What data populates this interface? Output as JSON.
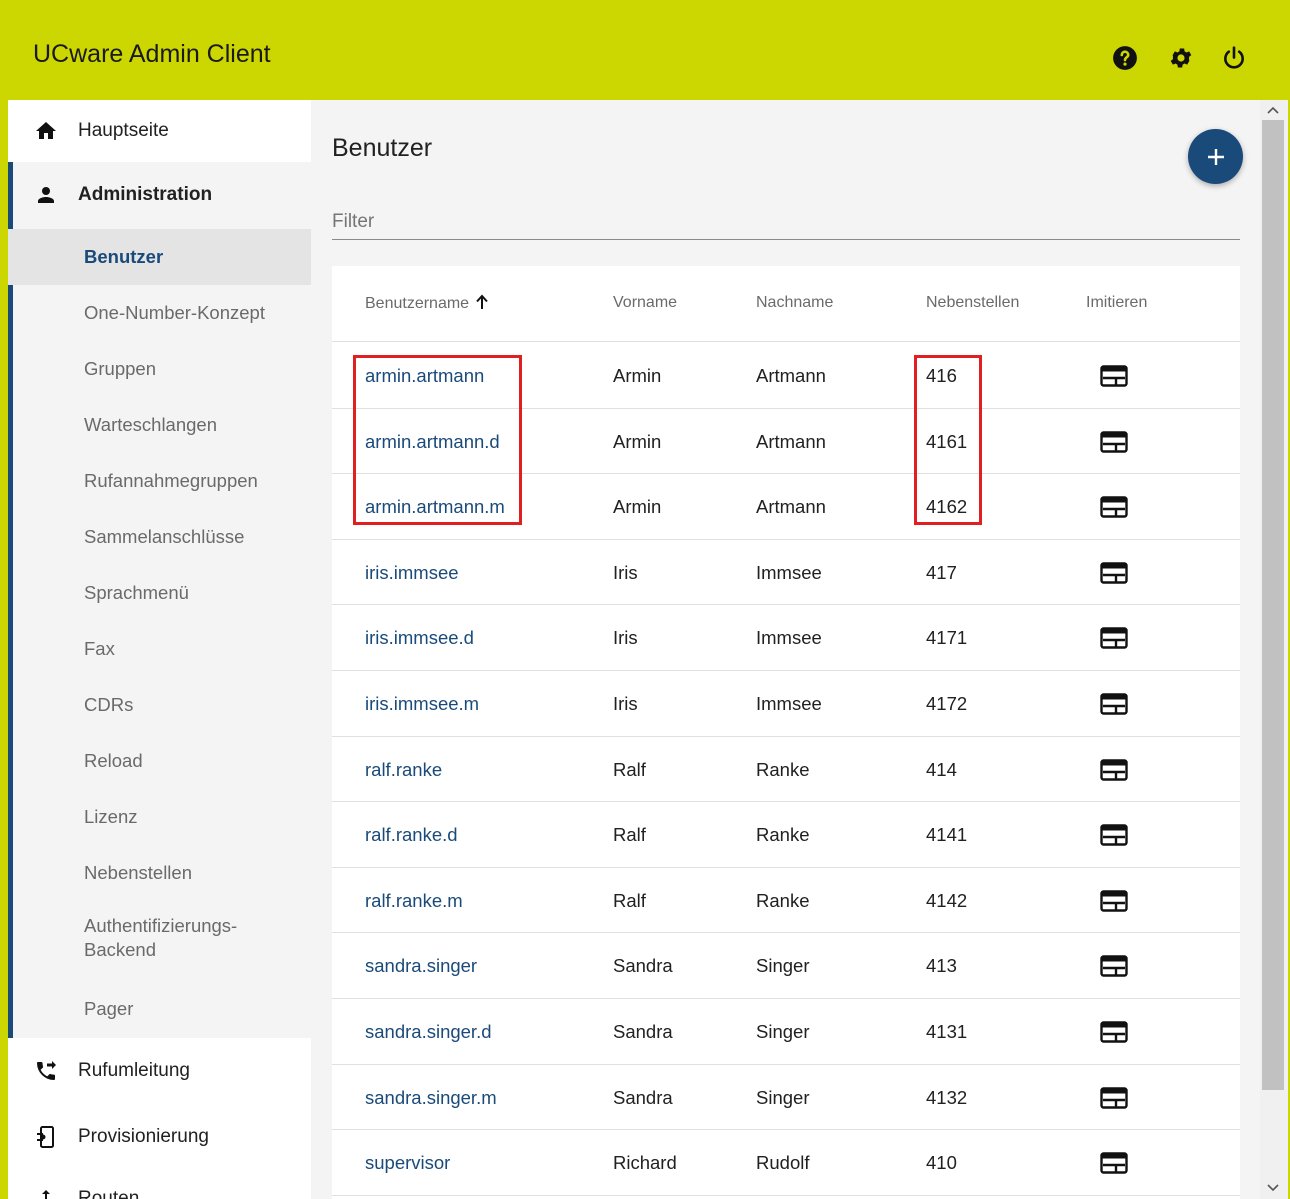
{
  "header": {
    "title": "UCware Admin Client",
    "bg_color": "#ccd600",
    "icons": [
      "help-icon",
      "gear-icon",
      "power-icon"
    ]
  },
  "sidebar": {
    "items": [
      {
        "label": "Hauptseite",
        "icon": "home-icon"
      },
      {
        "label": "Administration",
        "icon": "person-icon"
      },
      {
        "label": "Rufumleitung",
        "icon": "call-forward-icon"
      },
      {
        "label": "Provisionierung",
        "icon": "phonelink-setup-icon"
      },
      {
        "label": "Routen",
        "icon": "routing-icon"
      }
    ],
    "admin_subitems": [
      {
        "label": "Benutzer",
        "active": true
      },
      {
        "label": "One-Number-Konzept"
      },
      {
        "label": "Gruppen"
      },
      {
        "label": "Warteschlangen"
      },
      {
        "label": "Rufannahmegruppen"
      },
      {
        "label": "Sammelanschlüsse"
      },
      {
        "label": "Sprachmenü"
      },
      {
        "label": "Fax"
      },
      {
        "label": "CDRs"
      },
      {
        "label": "Reload"
      },
      {
        "label": "Lizenz"
      },
      {
        "label": "Nebenstellen"
      },
      {
        "label": "Authentifizierungs-\nBackend"
      },
      {
        "label": "Pager"
      }
    ],
    "accent_color": "#1a4a7a"
  },
  "main": {
    "title": "Benutzer",
    "filter_placeholder": "Filter",
    "table": {
      "columns": [
        "Benutzername",
        "Vorname",
        "Nachname",
        "Nebenstellen",
        "Imitieren"
      ],
      "sort_column": "Benutzername",
      "sort_direction": "ascending",
      "rows": [
        {
          "username": "armin.artmann",
          "firstname": "Armin",
          "lastname": "Artmann",
          "extension": "416"
        },
        {
          "username": "armin.artmann.d",
          "firstname": "Armin",
          "lastname": "Artmann",
          "extension": "4161"
        },
        {
          "username": "armin.artmann.m",
          "firstname": "Armin",
          "lastname": "Artmann",
          "extension": "4162"
        },
        {
          "username": "iris.immsee",
          "firstname": "Iris",
          "lastname": "Immsee",
          "extension": "417"
        },
        {
          "username": "iris.immsee.d",
          "firstname": "Iris",
          "lastname": "Immsee",
          "extension": "4171"
        },
        {
          "username": "iris.immsee.m",
          "firstname": "Iris",
          "lastname": "Immsee",
          "extension": "4172"
        },
        {
          "username": "ralf.ranke",
          "firstname": "Ralf",
          "lastname": "Ranke",
          "extension": "414"
        },
        {
          "username": "ralf.ranke.d",
          "firstname": "Ralf",
          "lastname": "Ranke",
          "extension": "4141"
        },
        {
          "username": "ralf.ranke.m",
          "firstname": "Ralf",
          "lastname": "Ranke",
          "extension": "4142"
        },
        {
          "username": "sandra.singer",
          "firstname": "Sandra",
          "lastname": "Singer",
          "extension": "413"
        },
        {
          "username": "sandra.singer.d",
          "firstname": "Sandra",
          "lastname": "Singer",
          "extension": "4131"
        },
        {
          "username": "sandra.singer.m",
          "firstname": "Sandra",
          "lastname": "Singer",
          "extension": "4132"
        },
        {
          "username": "supervisor",
          "firstname": "Richard",
          "lastname": "Rudolf",
          "extension": "410"
        }
      ]
    },
    "link_color": "#1a4a7a",
    "highlight_color": "#e02020"
  }
}
